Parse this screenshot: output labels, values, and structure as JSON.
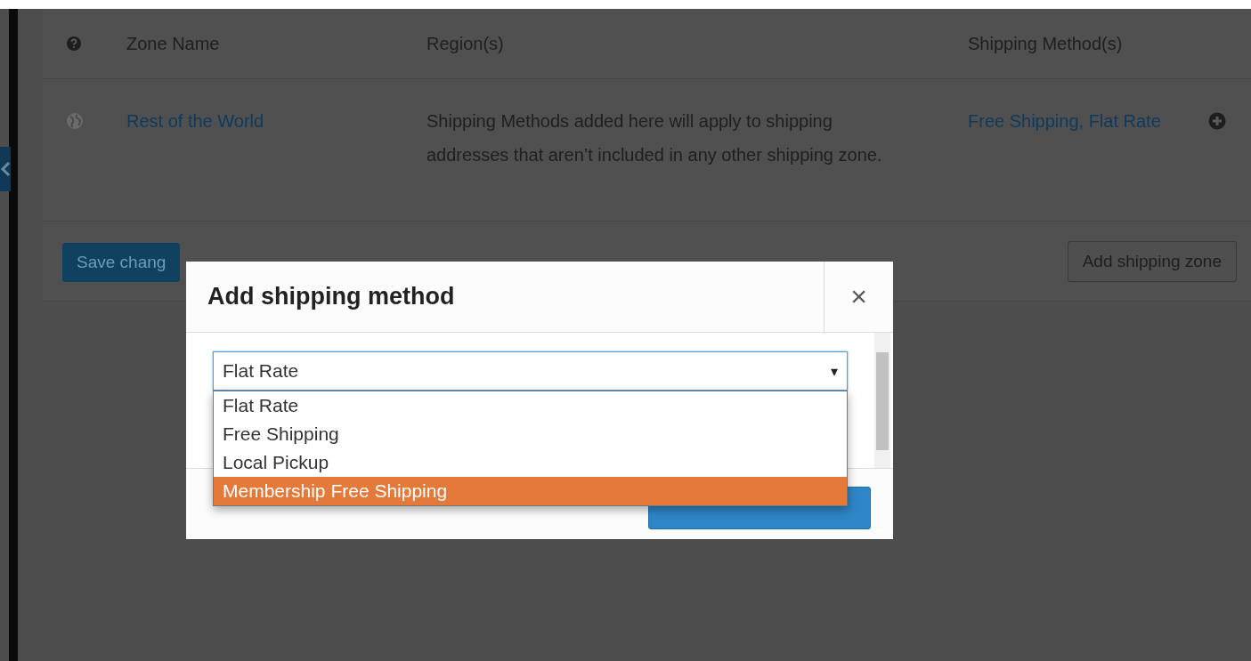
{
  "table": {
    "columns": [
      "Zone Name",
      "Region(s)",
      "Shipping Method(s)"
    ],
    "rows": [
      {
        "zone_name": "Rest of the World",
        "regions": "Shipping Methods added here will apply to shipping addresses that aren’t included in any other shipping zone.",
        "shipping_methods": "Free Shipping, Flat Rate"
      }
    ]
  },
  "footer": {
    "save_button": "Save chang",
    "add_zone_button": "Add shipping zone"
  },
  "modal": {
    "title": "Add shipping method",
    "close": "×",
    "select": {
      "value": "Flat Rate",
      "caret": "▾",
      "options": [
        {
          "label": "Flat Rate",
          "highlighted": false
        },
        {
          "label": "Free Shipping",
          "highlighted": false
        },
        {
          "label": "Local Pickup",
          "highlighted": false
        },
        {
          "label": "Membership Free Shipping",
          "highlighted": true
        }
      ]
    }
  }
}
